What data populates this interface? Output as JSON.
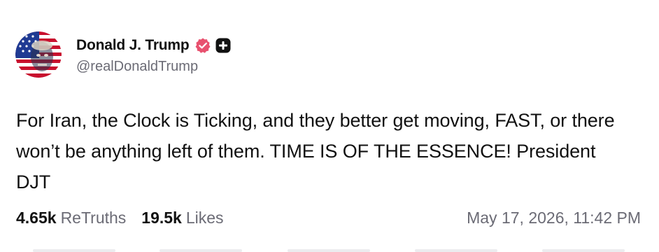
{
  "post": {
    "author": {
      "display_name": "Donald J. Trump",
      "handle": "@realDonaldTrump",
      "verified_icon": "verified-badge-icon",
      "verified_color": "#e8516f",
      "plus_icon": "plus-square-icon"
    },
    "content": "For Iran, the Clock is Ticking, and they better get moving, FAST, or there won’t be anything left of them. TIME IS OF THE ESSENCE! President DJT",
    "stats": {
      "retruths_count": "4.65k",
      "retruths_label": "ReTruths",
      "likes_count": "19.5k",
      "likes_label": "Likes"
    },
    "timestamp": "May 17, 2026, 11:42 PM"
  },
  "colors": {
    "text_primary": "#111111",
    "text_secondary": "#6b6b75",
    "flag_red": "#c8102e",
    "flag_blue": "#1f3a93"
  }
}
